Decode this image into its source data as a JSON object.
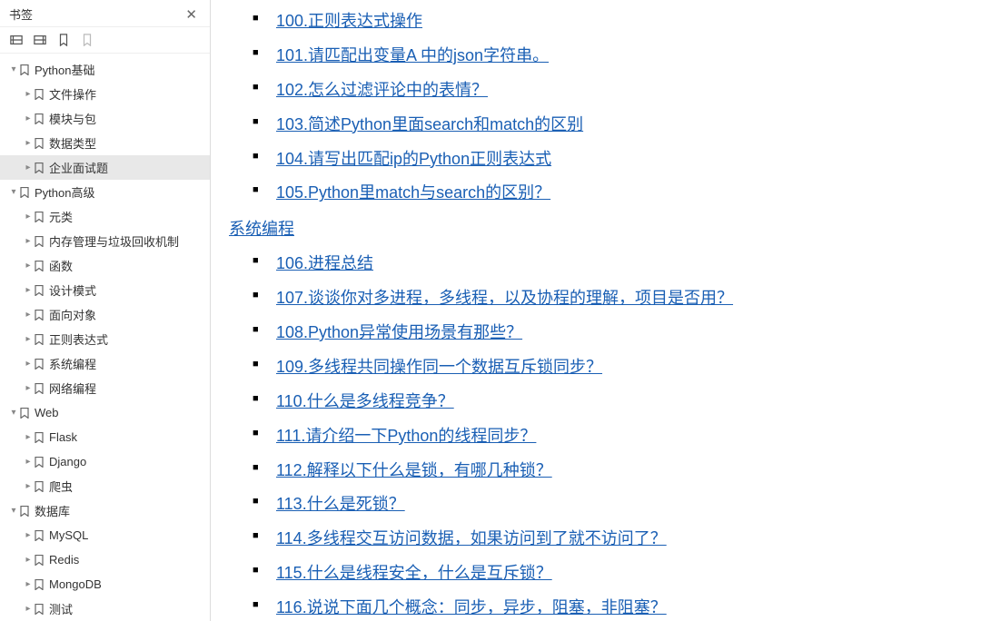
{
  "sidebar": {
    "title": "书签",
    "tree": [
      {
        "label": "Python基础",
        "level": 0,
        "arrow": "down",
        "selected": false
      },
      {
        "label": "文件操作",
        "level": 1,
        "arrow": "right",
        "selected": false
      },
      {
        "label": "模块与包",
        "level": 1,
        "arrow": "right",
        "selected": false
      },
      {
        "label": "数据类型",
        "level": 1,
        "arrow": "right",
        "selected": false
      },
      {
        "label": "企业面试题",
        "level": 1,
        "arrow": "right",
        "selected": true
      },
      {
        "label": "Python高级",
        "level": 0,
        "arrow": "down",
        "selected": false
      },
      {
        "label": "元类",
        "level": 1,
        "arrow": "right",
        "selected": false
      },
      {
        "label": "内存管理与垃圾回收机制",
        "level": 1,
        "arrow": "right",
        "selected": false
      },
      {
        "label": "函数",
        "level": 1,
        "arrow": "right",
        "selected": false
      },
      {
        "label": "设计模式",
        "level": 1,
        "arrow": "right",
        "selected": false
      },
      {
        "label": "面向对象",
        "level": 1,
        "arrow": "right",
        "selected": false
      },
      {
        "label": "正则表达式",
        "level": 1,
        "arrow": "right",
        "selected": false
      },
      {
        "label": "系统编程",
        "level": 1,
        "arrow": "right",
        "selected": false
      },
      {
        "label": "网络编程",
        "level": 1,
        "arrow": "right",
        "selected": false
      },
      {
        "label": "Web",
        "level": 0,
        "arrow": "down",
        "selected": false
      },
      {
        "label": "Flask",
        "level": 1,
        "arrow": "right",
        "selected": false
      },
      {
        "label": "Django",
        "level": 1,
        "arrow": "right",
        "selected": false
      },
      {
        "label": "爬虫",
        "level": 1,
        "arrow": "right",
        "selected": false
      },
      {
        "label": "数据库",
        "level": 0,
        "arrow": "down",
        "selected": false
      },
      {
        "label": "MySQL",
        "level": 1,
        "arrow": "right",
        "selected": false
      },
      {
        "label": "Redis",
        "level": 1,
        "arrow": "right",
        "selected": false
      },
      {
        "label": "MongoDB",
        "level": 1,
        "arrow": "right",
        "selected": false
      },
      {
        "label": "测试",
        "level": 1,
        "arrow": "right",
        "selected": false
      }
    ]
  },
  "content": {
    "group1": [
      "100.正则表达式操作",
      "101.请匹配出变量A 中的json字符串。",
      "102.怎么过滤评论中的表情？",
      "103.简述Python里面search和match的区别",
      "104.请写出匹配ip的Python正则表达式",
      "105.Python里match与search的区别？"
    ],
    "heading": "系统编程",
    "group2": [
      "106.进程总结",
      "107.谈谈你对多进程，多线程，以及协程的理解，项目是否用？",
      "108.Python异常使用场景有那些？",
      "109.多线程共同操作同一个数据互斥锁同步？",
      "110.什么是多线程竞争？",
      "111.请介绍一下Python的线程同步？",
      "112.解释以下什么是锁，有哪几种锁？",
      "113.什么是死锁？",
      "114.多线程交互访问数据，如果访问到了就不访问了？",
      "115.什么是线程安全，什么是互斥锁？",
      "116.说说下面几个概念：同步，异步，阻塞，非阻塞？"
    ]
  }
}
